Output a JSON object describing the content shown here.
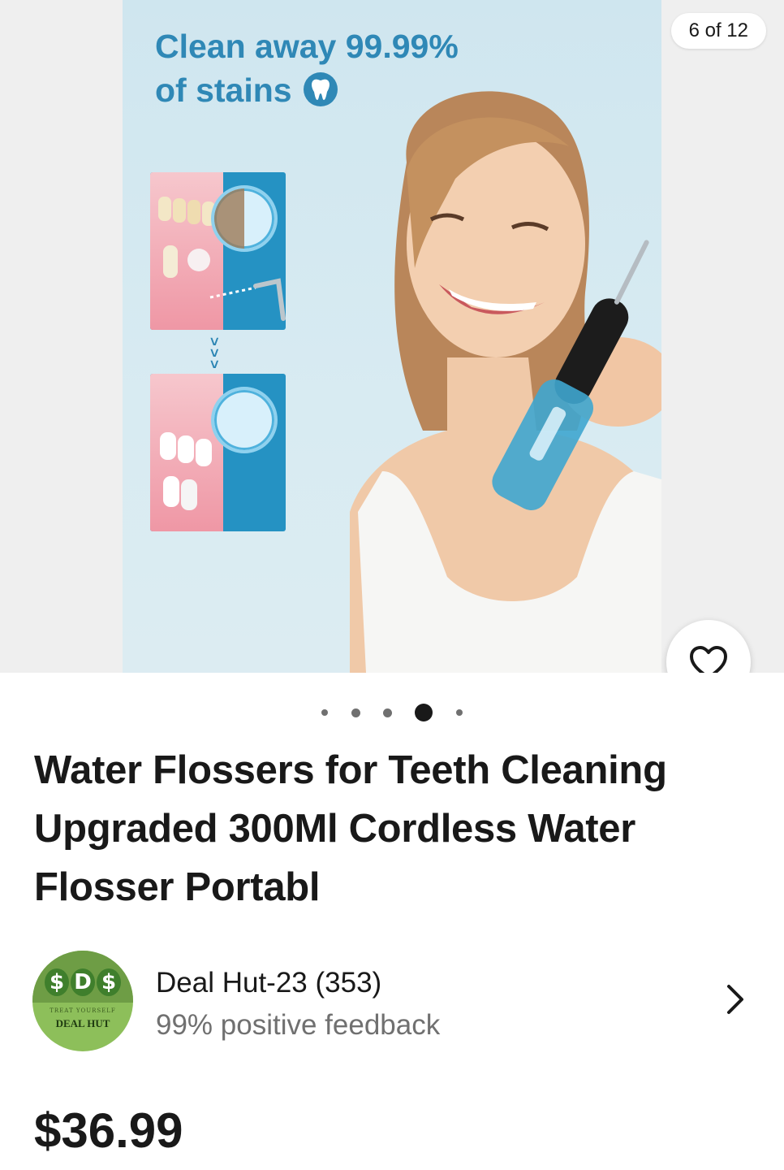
{
  "gallery": {
    "counter": "6 of 12",
    "image": {
      "headline_line1": "Clean away 99.99%",
      "headline_line2": "of stains",
      "arrows": "»»"
    },
    "watch_icon": "heart-icon",
    "pagination": {
      "current_index": 3,
      "visible_dots": 5
    }
  },
  "listing": {
    "title": "Water Flossers for Teeth Cleaning Upgraded 300Ml Cordless Water Flosser Portabl",
    "price": "$36.99"
  },
  "seller": {
    "name": "Deal Hut-23 (353)",
    "feedback": "99% positive feedback",
    "logo": {
      "letters": [
        "$",
        "D",
        "$"
      ],
      "tagline": "TREAT YOURSELF",
      "name": "DEAL HUT"
    },
    "chevron_icon": "chevron-right-icon"
  },
  "colors": {
    "headline_blue": "#2f88b6",
    "text_primary": "#191919",
    "text_secondary": "#707070",
    "logo_green": "#6e9d45"
  }
}
